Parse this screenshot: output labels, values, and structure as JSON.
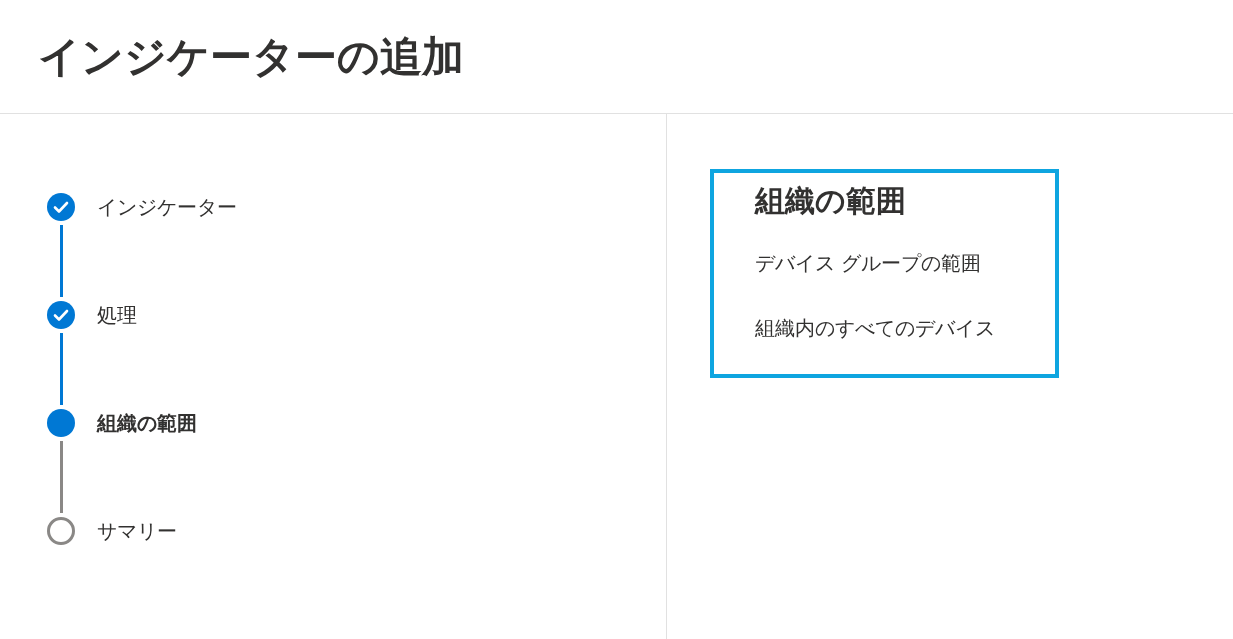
{
  "title": "インジケーターの追加",
  "steps": [
    {
      "label": "インジケーター",
      "completed": true,
      "selected": false
    },
    {
      "label": "処理",
      "completed": true,
      "selected": false
    },
    {
      "label": "組織の範囲",
      "completed": false,
      "selected": true
    },
    {
      "label": "サマリー",
      "completed": false,
      "selected": false
    }
  ],
  "scope_panel": {
    "heading": "組織の範囲",
    "options": [
      "デバイス グループの範囲",
      "組織内のすべてのデバイス"
    ]
  }
}
